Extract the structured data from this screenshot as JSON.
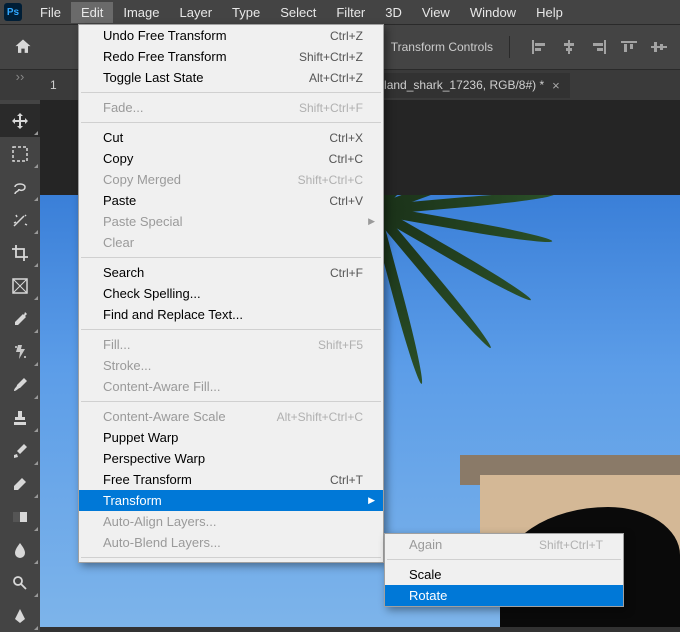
{
  "menubar": {
    "items": [
      "File",
      "Edit",
      "Image",
      "Layer",
      "Type",
      "Select",
      "Filter",
      "3D",
      "View",
      "Window",
      "Help"
    ],
    "active": "Edit"
  },
  "optionsbar": {
    "label": "Transform Controls"
  },
  "doc_tab": {
    "prefix": "1",
    "title": "enland_shark_17236, RGB/8#) *"
  },
  "edit_menu": {
    "items": [
      {
        "label": "Undo Free Transform",
        "shortcut": "Ctrl+Z",
        "enabled": true
      },
      {
        "label": "Redo Free Transform",
        "shortcut": "Shift+Ctrl+Z",
        "enabled": true
      },
      {
        "label": "Toggle Last State",
        "shortcut": "Alt+Ctrl+Z",
        "enabled": true
      },
      {
        "sep": true
      },
      {
        "label": "Fade...",
        "shortcut": "Shift+Ctrl+F",
        "enabled": false
      },
      {
        "sep": true
      },
      {
        "label": "Cut",
        "shortcut": "Ctrl+X",
        "enabled": true
      },
      {
        "label": "Copy",
        "shortcut": "Ctrl+C",
        "enabled": true
      },
      {
        "label": "Copy Merged",
        "shortcut": "Shift+Ctrl+C",
        "enabled": false
      },
      {
        "label": "Paste",
        "shortcut": "Ctrl+V",
        "enabled": true
      },
      {
        "label": "Paste Special",
        "shortcut": "",
        "enabled": false,
        "submenu": true
      },
      {
        "label": "Clear",
        "shortcut": "",
        "enabled": false
      },
      {
        "sep": true
      },
      {
        "label": "Search",
        "shortcut": "Ctrl+F",
        "enabled": true
      },
      {
        "label": "Check Spelling...",
        "shortcut": "",
        "enabled": true
      },
      {
        "label": "Find and Replace Text...",
        "shortcut": "",
        "enabled": true
      },
      {
        "sep": true
      },
      {
        "label": "Fill...",
        "shortcut": "Shift+F5",
        "enabled": false
      },
      {
        "label": "Stroke...",
        "shortcut": "",
        "enabled": false
      },
      {
        "label": "Content-Aware Fill...",
        "shortcut": "",
        "enabled": false
      },
      {
        "sep": true
      },
      {
        "label": "Content-Aware Scale",
        "shortcut": "Alt+Shift+Ctrl+C",
        "enabled": false
      },
      {
        "label": "Puppet Warp",
        "shortcut": "",
        "enabled": true
      },
      {
        "label": "Perspective Warp",
        "shortcut": "",
        "enabled": true
      },
      {
        "label": "Free Transform",
        "shortcut": "Ctrl+T",
        "enabled": true
      },
      {
        "label": "Transform",
        "shortcut": "",
        "enabled": true,
        "submenu": true,
        "highlight": true
      },
      {
        "label": "Auto-Align Layers...",
        "shortcut": "",
        "enabled": false
      },
      {
        "label": "Auto-Blend Layers...",
        "shortcut": "",
        "enabled": false
      },
      {
        "sep": true
      }
    ]
  },
  "transform_submenu": {
    "items": [
      {
        "label": "Again",
        "shortcut": "Shift+Ctrl+T",
        "enabled": false
      },
      {
        "sep": true
      },
      {
        "label": "Scale",
        "shortcut": "",
        "enabled": true
      },
      {
        "label": "Rotate",
        "shortcut": "",
        "enabled": true,
        "highlight": true
      }
    ]
  },
  "tools": [
    "move",
    "marquee",
    "lasso",
    "wand",
    "crop",
    "frame",
    "eyedropper",
    "heal",
    "brush",
    "stamp",
    "history",
    "eraser",
    "gradient",
    "blur",
    "dodge",
    "pen"
  ]
}
